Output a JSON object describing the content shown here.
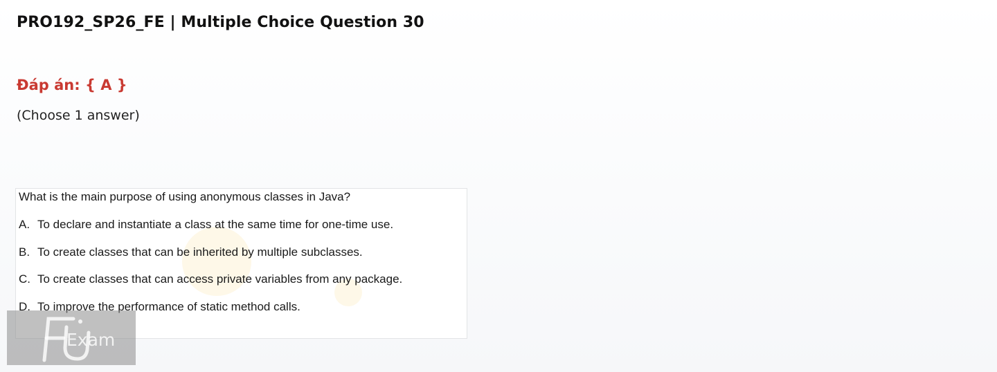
{
  "header": {
    "title": "PRO192_SP26_FE | Multiple Choice Question 30"
  },
  "answer": {
    "label": "Đáp án: { A }"
  },
  "instruction": {
    "text": "(Choose 1 answer)"
  },
  "question": {
    "text": "What is the main purpose of using anonymous classes in Java?",
    "options": [
      {
        "letter": "A.",
        "text": "To declare and instantiate a class at the same time for one-time use."
      },
      {
        "letter": "B.",
        "text": "To create classes that can be inherited by multiple subclasses."
      },
      {
        "letter": "C.",
        "text": "To create classes that can access private variables from any package."
      },
      {
        "letter": "D.",
        "text": "To improve the performance of static method calls."
      }
    ]
  },
  "logo": {
    "text": "Exam",
    "icon": "fu-exam-logo-icon"
  },
  "colors": {
    "answer_red": "#c93a32",
    "title_text": "#111111",
    "logo_bg": "#8c8c8c"
  }
}
